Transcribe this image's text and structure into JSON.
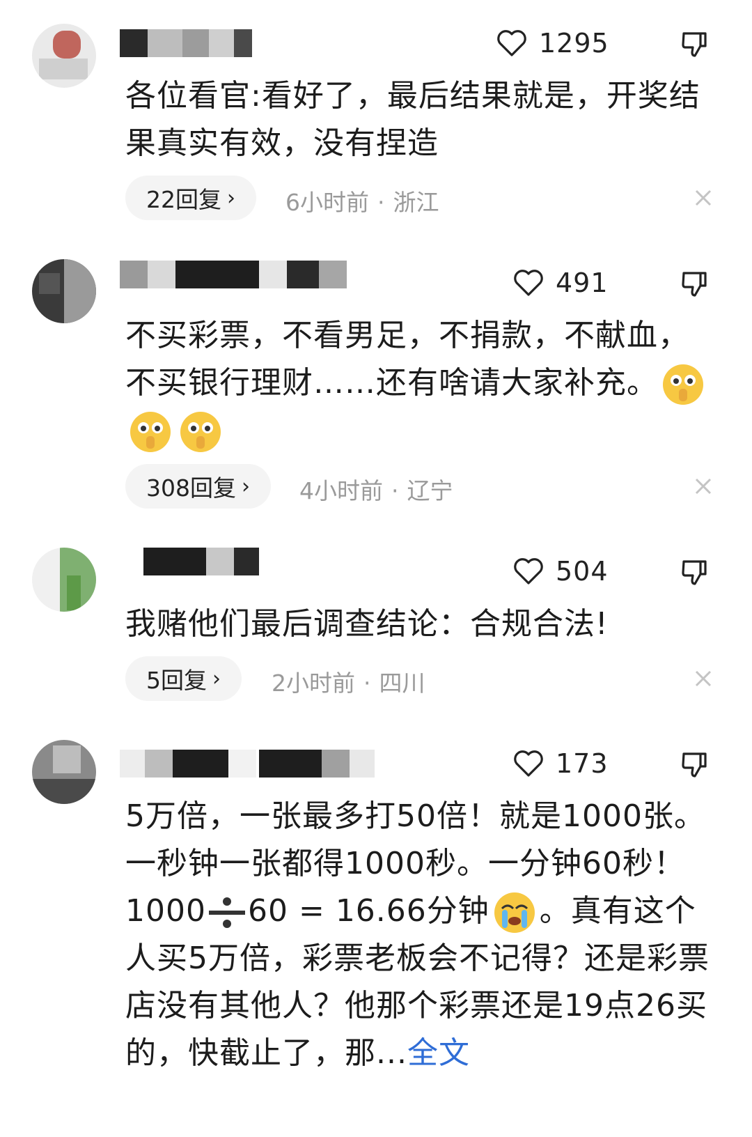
{
  "comments": [
    {
      "likes": "1295",
      "text": "各位看官:看好了，最后结果就是，开奖结果真实有效，没有捏造",
      "replies": "22回复",
      "time": "6小时前",
      "location": "浙江"
    },
    {
      "likes": "491",
      "text": "不买彩票，不看男足，不捐款，不献血，不买银行理财……还有啥请大家补充。",
      "replies": "308回复",
      "time": "4小时前",
      "location": "辽宁"
    },
    {
      "likes": "504",
      "text": "我赌他们最后调查结论：合规合法!",
      "replies": "5回复",
      "time": "2小时前",
      "location": "四川"
    },
    {
      "likes": "173",
      "text_part1": "5万倍，一张最多打50倍！就是1000张。一秒钟一张都得1000秒。一分钟60秒！1000",
      "text_part2": "60 = 16.66分钟",
      "text_part3": "。真有这个人买5万倍，彩票老板会不记得？还是彩票店没有其他人？他那个彩票还是19点26买的，快截止了，那...",
      "more": "全文"
    }
  ],
  "separator": "·",
  "icons": {
    "like": "heart-outline-icon",
    "dislike": "thumbs-down-icon",
    "close": "close-x-icon",
    "chevron": "chevron-right-icon"
  },
  "colors": {
    "link": "#2f6dd6",
    "meta": "#9a9a9a",
    "pill": "#f4f4f4"
  }
}
